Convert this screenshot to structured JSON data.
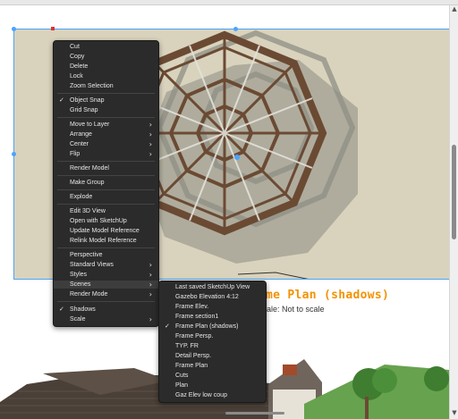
{
  "context_menu": {
    "items": [
      {
        "label": "Cut",
        "checked": false,
        "submenu": false
      },
      {
        "label": "Copy",
        "checked": false,
        "submenu": false
      },
      {
        "label": "Delete",
        "checked": false,
        "submenu": false
      },
      {
        "label": "Lock",
        "checked": false,
        "submenu": false
      },
      {
        "label": "Zoom Selection",
        "checked": false,
        "submenu": false
      },
      {
        "label": "Object Snap",
        "checked": true,
        "submenu": false
      },
      {
        "label": "Grid Snap",
        "checked": false,
        "submenu": false
      },
      {
        "label": "Move to Layer",
        "checked": false,
        "submenu": true
      },
      {
        "label": "Arrange",
        "checked": false,
        "submenu": true
      },
      {
        "label": "Center",
        "checked": false,
        "submenu": true
      },
      {
        "label": "Flip",
        "checked": false,
        "submenu": true
      },
      {
        "label": "Render Model",
        "checked": false,
        "submenu": false
      },
      {
        "label": "Make Group",
        "checked": false,
        "submenu": false
      },
      {
        "label": "Explode",
        "checked": false,
        "submenu": false
      },
      {
        "label": "Edit 3D View",
        "checked": false,
        "submenu": false
      },
      {
        "label": "Open with SketchUp",
        "checked": false,
        "submenu": false
      },
      {
        "label": "Update Model Reference",
        "checked": false,
        "submenu": false
      },
      {
        "label": "Relink Model Reference",
        "checked": false,
        "submenu": false
      },
      {
        "label": "Perspective",
        "checked": false,
        "submenu": false
      },
      {
        "label": "Standard Views",
        "checked": false,
        "submenu": true
      },
      {
        "label": "Styles",
        "checked": false,
        "submenu": true
      },
      {
        "label": "Scenes",
        "checked": false,
        "submenu": true
      },
      {
        "label": "Render Mode",
        "checked": false,
        "submenu": true
      },
      {
        "label": "Shadows",
        "checked": true,
        "submenu": false
      },
      {
        "label": "Scale",
        "checked": false,
        "submenu": true
      }
    ]
  },
  "scenes_menu": {
    "items": [
      {
        "label": "Last saved SketchUp View",
        "checked": false
      },
      {
        "label": "Gazebo Elevation 4:12",
        "checked": false
      },
      {
        "label": "Frame Elev.",
        "checked": false
      },
      {
        "label": "Frame section1",
        "checked": false
      },
      {
        "label": "Frame Plan (shadows)",
        "checked": true
      },
      {
        "label": "Frame Persp.",
        "checked": false
      },
      {
        "label": "TYP. FR",
        "checked": false
      },
      {
        "label": "Detail Persp.",
        "checked": false
      },
      {
        "label": "Frame Plan",
        "checked": false
      },
      {
        "label": "Cuts",
        "checked": false
      },
      {
        "label": "Plan",
        "checked": false
      },
      {
        "label": "Gaz Elev low coup",
        "checked": false
      }
    ]
  },
  "document": {
    "title_visible": "me Plan (shadows)",
    "scale_visible": "ale: Not to scale"
  },
  "icons": {
    "check": "✓",
    "submenu_arrow": "›",
    "scroll_up": "▲",
    "scroll_down": "▼"
  },
  "colors": {
    "title_orange": "#f39200",
    "selection_blue": "#4aa3ff",
    "menu_bg": "#2b2b2b",
    "frame_brown": "#6b4a33"
  }
}
